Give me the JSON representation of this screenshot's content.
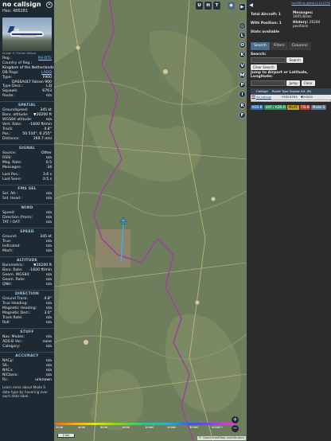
{
  "sidebar": {
    "callsign": "no callsign",
    "hex_label": "Hex:",
    "hex": "486281",
    "photo_credit": "Image © Florian Wessa",
    "rows": [
      {
        "k": "Reg.:",
        "v": "PH-DTE",
        "link": true
      },
      {
        "k": "Country of Reg.:",
        "v": "Kingdom of the Netherlands",
        "multi": true
      },
      {
        "k": "DB flags:",
        "v": "LADD",
        "link": true
      },
      {
        "k": "Type:",
        "v": "F900"
      },
      {
        "k": "",
        "v": "DASSAULT Falcon 900",
        "multi": true
      },
      {
        "k": "Type Desc.:",
        "v": "L3J"
      },
      {
        "k": "Squawk:",
        "v": "6763"
      },
      {
        "k": "Route:",
        "v": "n/a"
      }
    ],
    "sections": [
      {
        "title": "SPATIAL",
        "rows": [
          {
            "k": "Groundspeed:",
            "v": "345 kt"
          },
          {
            "k": "Baro. altitude:",
            "v": "▼20200 ft"
          },
          {
            "k": "WGS84 altitude:",
            "v": "n/a"
          },
          {
            "k": "Vert. Rate:",
            "v": "-1600 ft/min"
          },
          {
            "k": "Track:",
            "v": "4.8°"
          },
          {
            "k": "Pos.:",
            "v": "50.510°, 6.255°"
          },
          {
            "k": "Distance:",
            "v": "160.7 nmi"
          }
        ]
      },
      {
        "title": "SIGNAL",
        "rows": [
          {
            "k": "Source:",
            "v": "Other"
          },
          {
            "k": "RSSI:",
            "v": "n/a"
          },
          {
            "k": "Msg. Rate:",
            "v": "0.5"
          },
          {
            "k": "Messages:",
            "v": "34"
          },
          {
            "gap": true
          },
          {
            "k": "Last Pos.:",
            "v": "3.6 s"
          },
          {
            "k": "Last Seen:",
            "v": "0.5 s"
          }
        ]
      },
      {
        "title": "FMS SEL",
        "rows": [
          {
            "k": "Sel. Alt.:",
            "v": "n/a"
          },
          {
            "k": "Sel. Head.:",
            "v": "n/a"
          }
        ]
      },
      {
        "title": "WIND",
        "rows": [
          {
            "k": "Speed:",
            "v": "n/a"
          },
          {
            "k": "Direction (from):",
            "v": "n/a"
          },
          {
            "k": "TAT / OAT:",
            "v": "n/a"
          }
        ]
      },
      {
        "title": "SPEED",
        "rows": [
          {
            "k": "Ground:",
            "v": "345 kt"
          },
          {
            "k": "True:",
            "v": "n/a"
          },
          {
            "k": "Indicated:",
            "v": "n/a"
          },
          {
            "k": "Mach:",
            "v": "n/a"
          }
        ]
      },
      {
        "title": "ALTITUDE",
        "rows": [
          {
            "k": "Barometric:",
            "v": "▼20200 ft"
          },
          {
            "k": "Baro. Rate:",
            "v": "-1600 ft/min"
          },
          {
            "k": "Geom. WGS84:",
            "v": "n/a"
          },
          {
            "k": "Geom. Rate:",
            "v": "n/a"
          },
          {
            "k": "QNH:",
            "v": "n/a"
          }
        ]
      },
      {
        "title": "DIRECTION",
        "rows": [
          {
            "k": "Ground Track:",
            "v": "4.8°"
          },
          {
            "k": "True Heading:",
            "v": "n/a"
          },
          {
            "k": "Magnetic Heading:",
            "v": "n/a"
          },
          {
            "k": "Magnetic Decl.:",
            "v": "3.0°"
          },
          {
            "k": "Track Rate:",
            "v": "n/a"
          },
          {
            "k": "Roll:",
            "v": "n/a"
          }
        ]
      },
      {
        "title": "STUFF",
        "rows": [
          {
            "k": "Nav. Modes:",
            "v": "n/a"
          },
          {
            "k": "ADS-B Ver.:",
            "v": "none"
          },
          {
            "k": "Category:",
            "v": "n/a"
          }
        ]
      },
      {
        "title": "ACCURACY",
        "rows": [
          {
            "k": "NACp:",
            "v": "n/a"
          },
          {
            "k": "SIL:",
            "v": "n/a"
          },
          {
            "k": "NACv:",
            "v": "n/a"
          },
          {
            "k": "NICbaro:",
            "v": "n/a"
          },
          {
            "k": "Rc:",
            "v": "unknown"
          }
        ]
      }
    ],
    "footer": "Learn more about Mode S data type by hovering over each data label."
  },
  "map": {
    "right_buttons": [
      "▶",
      "◎",
      "L",
      "O",
      "K",
      "V",
      "M",
      "P",
      "I",
      "R",
      "F"
    ],
    "top_buttons": [
      "U",
      "H",
      "T"
    ],
    "scale": "2 km",
    "legend_labels": [
      "2000",
      "4000",
      "6000",
      "8000",
      "10000",
      "20000",
      "30000",
      "40000+"
    ],
    "zoom_in": "+",
    "zoom_out": "−",
    "attribution": "© OpenStreetMap contributors",
    "colors": {
      "aircraft": "#2fb7ff",
      "border": "#a94aa6"
    }
  },
  "right": {
    "top_link": "tar1090 on github (3.14.1570)",
    "toggle": "◀",
    "stats": {
      "total_label": "Total Aircraft:",
      "total": "1",
      "messages_label": "Messages:",
      "messages_value": "1605.8/sec",
      "position_label": "With Position:",
      "position": "1",
      "history_label": "History:",
      "history_value": "26284 positions",
      "stats_available": "Stats available"
    },
    "tabs": [
      "Search",
      "Filters",
      "Columns"
    ],
    "search_label": "Search:",
    "search_button": "Search",
    "clear_search": "Clear Search",
    "jump_label": "Jump to Airport or Latitude, Longitude:",
    "jump_button": "Jump",
    "clear_button": "Clear",
    "table": {
      "columns": [
        "",
        "Callsign",
        "Route",
        "Type",
        "Squawk",
        "Alt. (ft)"
      ],
      "rows": [
        {
          "flag": "NL",
          "callsign": "no callsign",
          "route": "",
          "type": "F900",
          "squawk": "6763",
          "alt": "▼20200"
        }
      ]
    },
    "badges": [
      {
        "text": "ADS-B",
        "bg": "#2e6ab0",
        "fg": "#fff"
      },
      {
        "text": "UAT / ADS-R",
        "bg": "#2a8f5a",
        "fg": "#fff"
      },
      {
        "text": "MLAT",
        "bg": "#c7a021",
        "fg": "#111"
      },
      {
        "text": "TIS-B",
        "bg": "#b63b2b",
        "fg": "#fff"
      },
      {
        "text": "Mode-S",
        "bg": "#5c7a95",
        "fg": "#fff"
      }
    ]
  }
}
